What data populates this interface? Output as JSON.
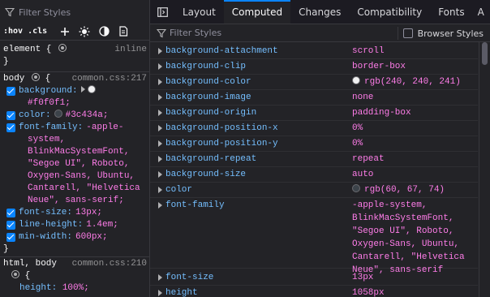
{
  "left": {
    "filter_placeholder": "Filter Styles",
    "toolbar": {
      "pseudo_label": ":hov",
      "cls_label": ".cls"
    },
    "element_rule": {
      "selector": "element {",
      "close": "}",
      "source": "inline"
    },
    "body_rule": {
      "selector": "body",
      "open": "{",
      "source": "common.css:217",
      "close": "}",
      "declarations": [
        {
          "name": "background:",
          "value": "#f0f0f1;",
          "swatch": "#f0f0f1"
        },
        {
          "name": "color:",
          "value": "#3c434a;",
          "swatch": "#3c434a"
        },
        {
          "name": "font-family:",
          "value": "-apple-system, BlinkMacSystemFont, \"Segoe UI\", Roboto, Oxygen-Sans, Ubuntu, Cantarell, \"Helvetica Neue\", sans-serif;"
        },
        {
          "name": "font-size:",
          "value": "13px;"
        },
        {
          "name": "line-height:",
          "value": "1.4em;"
        },
        {
          "name": "min-width:",
          "value": "600px;"
        }
      ],
      "font_family_lines": [
        "-apple-",
        "system,",
        "BlinkMacSystemFont,",
        "\"Segoe UI\", Roboto,",
        "Oxygen-Sans, Ubuntu,",
        "Cantarell, \"Helvetica",
        "Neue\", sans-serif;"
      ]
    },
    "html_body_rule": {
      "selector": "html, body",
      "source": "common.css:210",
      "open": "{",
      "declaration": {
        "name": "height:",
        "value": "100%;"
      }
    }
  },
  "tabs": [
    {
      "label": "Layout",
      "active": false
    },
    {
      "label": "Computed",
      "active": true
    },
    {
      "label": "Changes",
      "active": false
    },
    {
      "label": "Compatibility",
      "active": false
    },
    {
      "label": "Fonts",
      "active": false
    },
    {
      "label": "A",
      "active": false
    }
  ],
  "right_filter_placeholder": "Filter Styles",
  "browser_styles_label": "Browser Styles",
  "computed": [
    {
      "name": "background-attachment",
      "value": "scroll"
    },
    {
      "name": "background-clip",
      "value": "border-box"
    },
    {
      "name": "background-color",
      "value": "rgb(240, 240, 241)",
      "swatch": "#f0f0f1"
    },
    {
      "name": "background-image",
      "value": "none"
    },
    {
      "name": "background-origin",
      "value": "padding-box"
    },
    {
      "name": "background-position-x",
      "value": "0%"
    },
    {
      "name": "background-position-y",
      "value": "0%"
    },
    {
      "name": "background-repeat",
      "value": "repeat"
    },
    {
      "name": "background-size",
      "value": "auto"
    },
    {
      "name": "color",
      "value": "rgb(60, 67, 74)",
      "swatch": "#3c434a"
    },
    {
      "name": "font-family",
      "value": "-apple-system,\nBlinkMacSystemFont,\n\"Segoe UI\", Roboto,\nOxygen-Sans, Ubuntu,\nCantarell, \"Helvetica\nNeue\", sans-serif"
    },
    {
      "name": "font-size",
      "value": "13px"
    },
    {
      "name": "height",
      "value": "1058px"
    }
  ],
  "colors": {
    "accent": "#0a84ff",
    "property": "#75bfff",
    "value": "#ff7de9",
    "bg": "#232327"
  }
}
